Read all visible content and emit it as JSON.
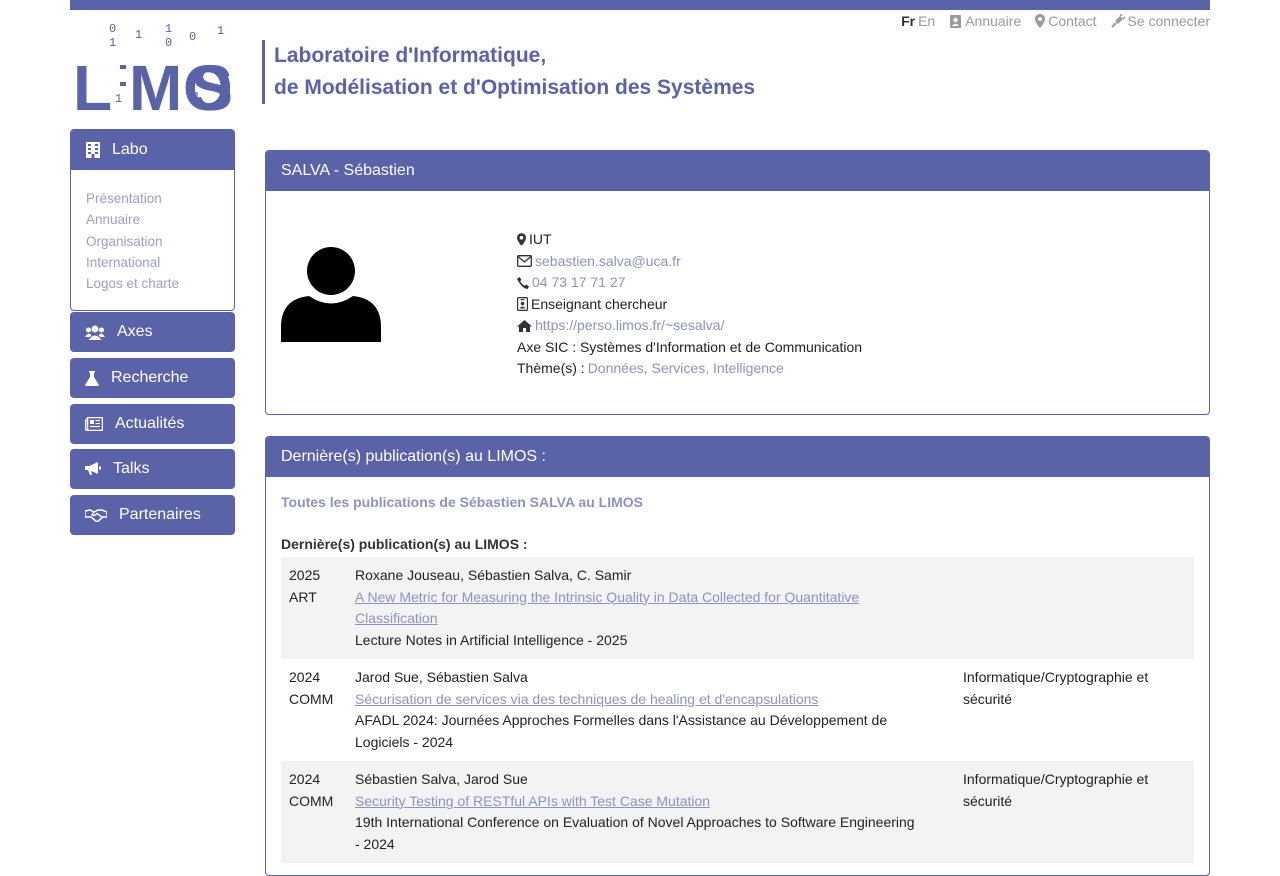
{
  "header": {
    "logo_text": "LIMOS",
    "title_line1": "Laboratoire d'Informatique,",
    "title_line2": "de Modélisation et d'Optimisation des Systèmes",
    "lang_fr": "Fr",
    "lang_en": "En",
    "annuaire": "Annuaire",
    "contact": "Contact",
    "login": "Se connecter",
    "accent_color": "#5a62a8"
  },
  "sidebar": {
    "labo_label": "Labo",
    "labo_items": [
      "Présentation",
      "Annuaire",
      "Organisation",
      "International",
      "Logos et charte"
    ],
    "axes_label": "Axes",
    "recherche_label": "Recherche",
    "actualites_label": "Actualités",
    "talks_label": "Talks",
    "partenaires_label": "Partenaires"
  },
  "profile": {
    "name": "SALVA - Sébastien",
    "location": "IUT",
    "email": "sebastien.salva@uca.fr",
    "phone": "04 73 17 71 27",
    "role": "Enseignant chercheur",
    "website": "https://perso.limos.fr/~sesalva/",
    "axe": "Axe SIC : Systèmes d'Information et de Communication",
    "themes_label": "Thème(s) :",
    "themes": "Données, Services, Intelligence"
  },
  "publications": {
    "panel_title": "Dernière(s) publication(s) au LIMOS :",
    "all_link": "Toutes les publications de Sébastien SALVA au LIMOS",
    "subtitle": "Dernière(s) publication(s) au LIMOS :",
    "items": [
      {
        "year": "2025",
        "type": "ART",
        "authors": "Roxane Jouseau, Sébastien Salva, C. Samir",
        "title": "A New Metric for Measuring the Intrinsic Quality in Data Collected for Quantitative Classification",
        "venue": "Lecture Notes in Artificial Intelligence - 2025",
        "category": ""
      },
      {
        "year": "2024",
        "type": "COMM",
        "authors": "Jarod Sue, Sébastien Salva",
        "title": "Sécurisation de services via des techniques de healing et d'encapsulations",
        "venue": "AFADL 2024: Journées Approches Formelles dans l'Assistance au Développement de Logiciels - 2024",
        "category": "Informatique/Cryptographie et sécurité"
      },
      {
        "year": "2024",
        "type": "COMM",
        "authors": "Sébastien Salva, Jarod Sue",
        "title": "Security Testing of RESTful APIs with Test Case Mutation",
        "venue": "19th International Conference on Evaluation of Novel Approaches to Software Engineering - 2024",
        "category": "Informatique/Cryptographie et sécurité"
      }
    ]
  }
}
